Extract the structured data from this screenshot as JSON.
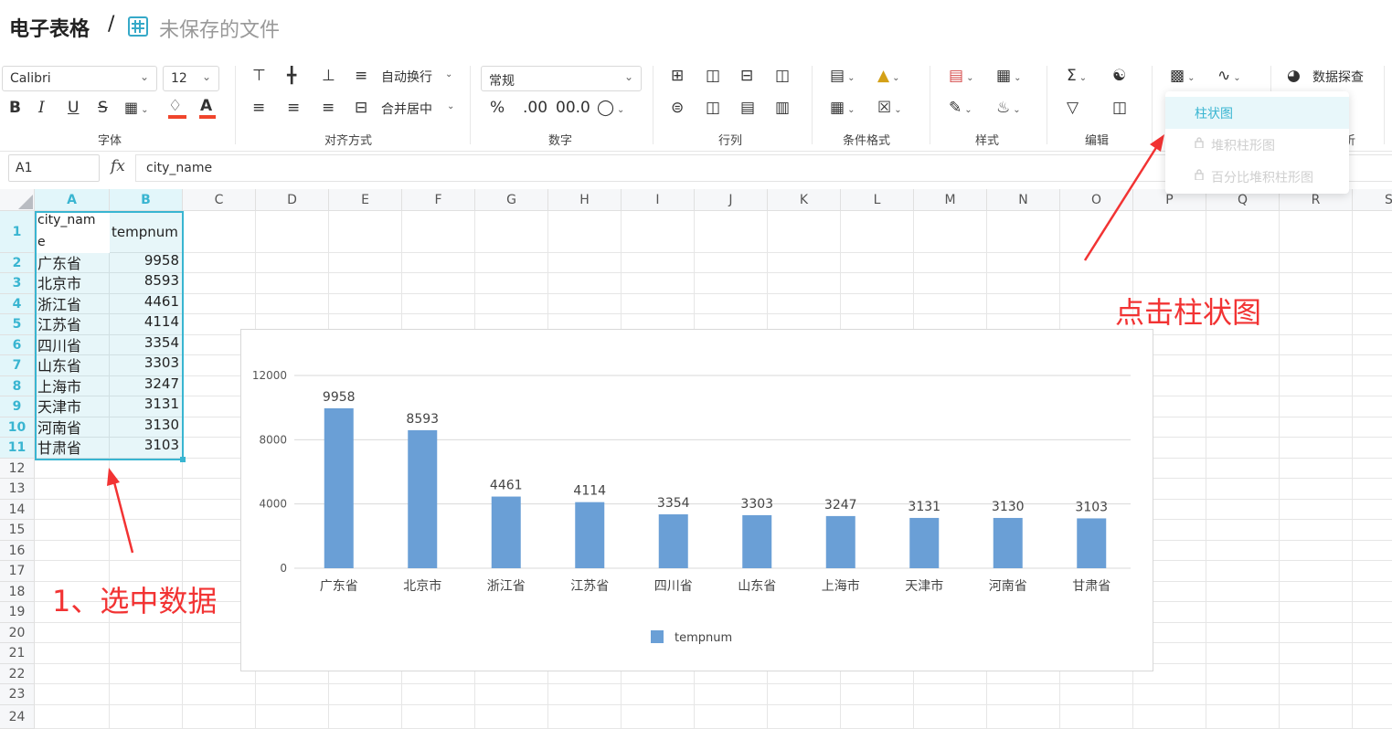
{
  "title": {
    "app": "电子表格",
    "separator": "/",
    "file": "未保存的文件"
  },
  "ribbon": {
    "font_name": "Calibri",
    "font_size": "12",
    "wrap_text": "自动换行",
    "merge_center": "合并居中",
    "number_format": "常规",
    "data_explore": "数据探查",
    "groups": {
      "font": "字体",
      "align": "对齐方式",
      "number": "数字",
      "rowcol": "行列",
      "cond": "条件格式",
      "style": "样式",
      "edit": "编辑",
      "analysis": "析"
    },
    "percent": "%",
    "decimal_dec": ".00",
    "decimal_inc": "00.0"
  },
  "dropdown": {
    "items": [
      "柱状图",
      "堆积柱形图",
      "百分比堆积柱形图"
    ]
  },
  "formula_bar": {
    "name_box": "A1",
    "fx": "fx",
    "formula": "city_name"
  },
  "columns": [
    "A",
    "B",
    "C",
    "D",
    "E",
    "F",
    "G",
    "H",
    "I",
    "J",
    "K",
    "L",
    "M",
    "N",
    "O",
    "P",
    "Q",
    "R",
    "S"
  ],
  "rows": [
    "1",
    "2",
    "3",
    "4",
    "5",
    "6",
    "7",
    "8",
    "9",
    "10",
    "11",
    "12",
    "13",
    "14",
    "15",
    "16",
    "17",
    "18",
    "19",
    "20",
    "21",
    "22",
    "23",
    "24"
  ],
  "sheet": {
    "a1_line1": "city_nam",
    "a1_line2": "e",
    "b1": "tempnum",
    "data": [
      [
        "广东省",
        "9958"
      ],
      [
        "北京市",
        "8593"
      ],
      [
        "浙江省",
        "4461"
      ],
      [
        "江苏省",
        "4114"
      ],
      [
        "四川省",
        "3354"
      ],
      [
        "山东省",
        "3303"
      ],
      [
        "上海市",
        "3247"
      ],
      [
        "天津市",
        "3131"
      ],
      [
        "河南省",
        "3130"
      ],
      [
        "甘肃省",
        "3103"
      ]
    ]
  },
  "annotations": {
    "select": "1、选中数据",
    "click": "点击柱状图"
  },
  "colors": {
    "accent": "#39b5d1",
    "bar": "#6a9fd6",
    "annotation": "#f23333"
  },
  "chart_data": {
    "type": "bar",
    "categories": [
      "广东省",
      "北京市",
      "浙江省",
      "江苏省",
      "四川省",
      "山东省",
      "上海市",
      "天津市",
      "河南省",
      "甘肃省"
    ],
    "series": [
      {
        "name": "tempnum",
        "values": [
          9958,
          8593,
          4461,
          4114,
          3354,
          3303,
          3247,
          3131,
          3130,
          3103
        ]
      }
    ],
    "yticks": [
      "0",
      "4000",
      "8000",
      "12000"
    ],
    "ylim": [
      0,
      12000
    ],
    "grid": true,
    "legend": "bottom"
  }
}
